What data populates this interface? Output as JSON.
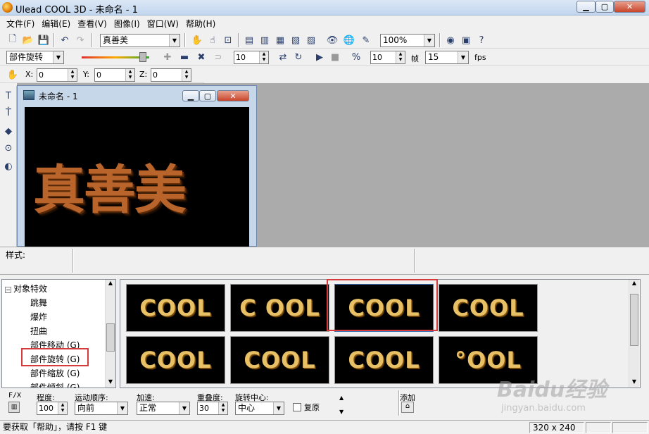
{
  "app": {
    "title": "Ulead COOL 3D - 未命名 - 1"
  },
  "menu": [
    "文件(F)",
    "编辑(E)",
    "查看(V)",
    "图像(I)",
    "窗口(W)",
    "帮助(H)"
  ],
  "toolbar1": {
    "text_value": "真善美",
    "zoom_value": "100%"
  },
  "toolbar2": {
    "effect_value": "部件旋转",
    "frames_value": "10",
    "frame_num_value": "10",
    "frame_label": "帧",
    "fps_value": "15",
    "fps_label": "fps"
  },
  "toolbar3": {
    "x_label": "X:",
    "x_value": "0",
    "y_label": "Y:",
    "y_value": "0",
    "z_label": "Z:",
    "z_value": "0"
  },
  "docwin": {
    "title": "未命名 - 1",
    "canvas_text": "真善美"
  },
  "stylebar": {
    "label": "样式:"
  },
  "tree": {
    "root": "对象特效",
    "items": [
      "跳舞",
      "爆炸",
      "扭曲",
      "部件移动 (G)",
      "部件旋转 (G)",
      "部件缩放 (G)",
      "部件倾斜 (G)"
    ],
    "selected_index": 4
  },
  "thumbs": [
    "COOL",
    "C OOL",
    "COOL",
    "COOL",
    "COOL",
    "COOL",
    "COOL",
    "°OOL"
  ],
  "options": {
    "fx_label": "F/X",
    "degree_label": "程度:",
    "degree_value": "100",
    "order_label": "运动顺序:",
    "order_value": "向前",
    "accel_label": "加速:",
    "accel_value": "正常",
    "overlap_label": "重叠度:",
    "overlap_value": "30",
    "center_label": "旋转中心:",
    "center_value": "中心",
    "restore_label": "复原",
    "add_label": "添加"
  },
  "status": {
    "help_text": "要获取「帮助」，请按 F1 键",
    "size_text": "320 x 240"
  },
  "watermark": {
    "brand": "Baidu经验",
    "url": "jingyan.baidu.com"
  },
  "colors": {
    "highlight_red": "#d63b3b",
    "wood": "#b8642a",
    "gold": "#e8c066"
  }
}
